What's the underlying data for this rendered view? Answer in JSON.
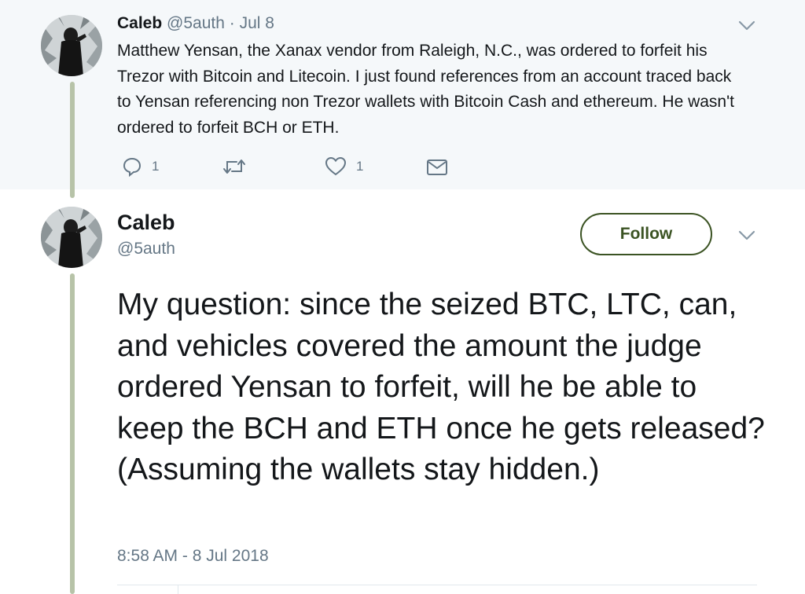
{
  "parent_tweet": {
    "author_name": "Caleb",
    "author_handle": "@5auth",
    "separator": "·",
    "date": "Jul 8",
    "text": "Matthew Yensan, the Xanax vendor from Raleigh, N.C., was ordered to forfeit his Trezor with Bitcoin and Litecoin. I just found references from an account traced back to Yensan referencing non Trezor wallets with Bitcoin Cash and ethereum. He wasn't ordered to forfeit BCH or ETH.",
    "reply_count": "1",
    "retweet_count": "",
    "like_count": "1"
  },
  "main_tweet": {
    "author_name": "Caleb",
    "author_handle": "@5auth",
    "follow_label": "Follow",
    "text": "My question: since the seized BTC, LTC, can, and vehicles covered the amount the judge ordered Yensan to forfeit, will he be able to keep the BCH and ETH once he gets released? (Assuming the wallets stay hidden.)",
    "timestamp": "8:58 AM - 8 Jul 2018"
  },
  "icons": {
    "reply": "reply-icon",
    "retweet": "retweet-icon",
    "like": "heart-icon",
    "dm": "envelope-icon",
    "menu": "chevron-down-icon"
  },
  "colors": {
    "parent_background": "#f5f8fa",
    "thread_line": "#b7c3a8",
    "muted_text": "#657786",
    "follow_accent": "#3b5323"
  }
}
